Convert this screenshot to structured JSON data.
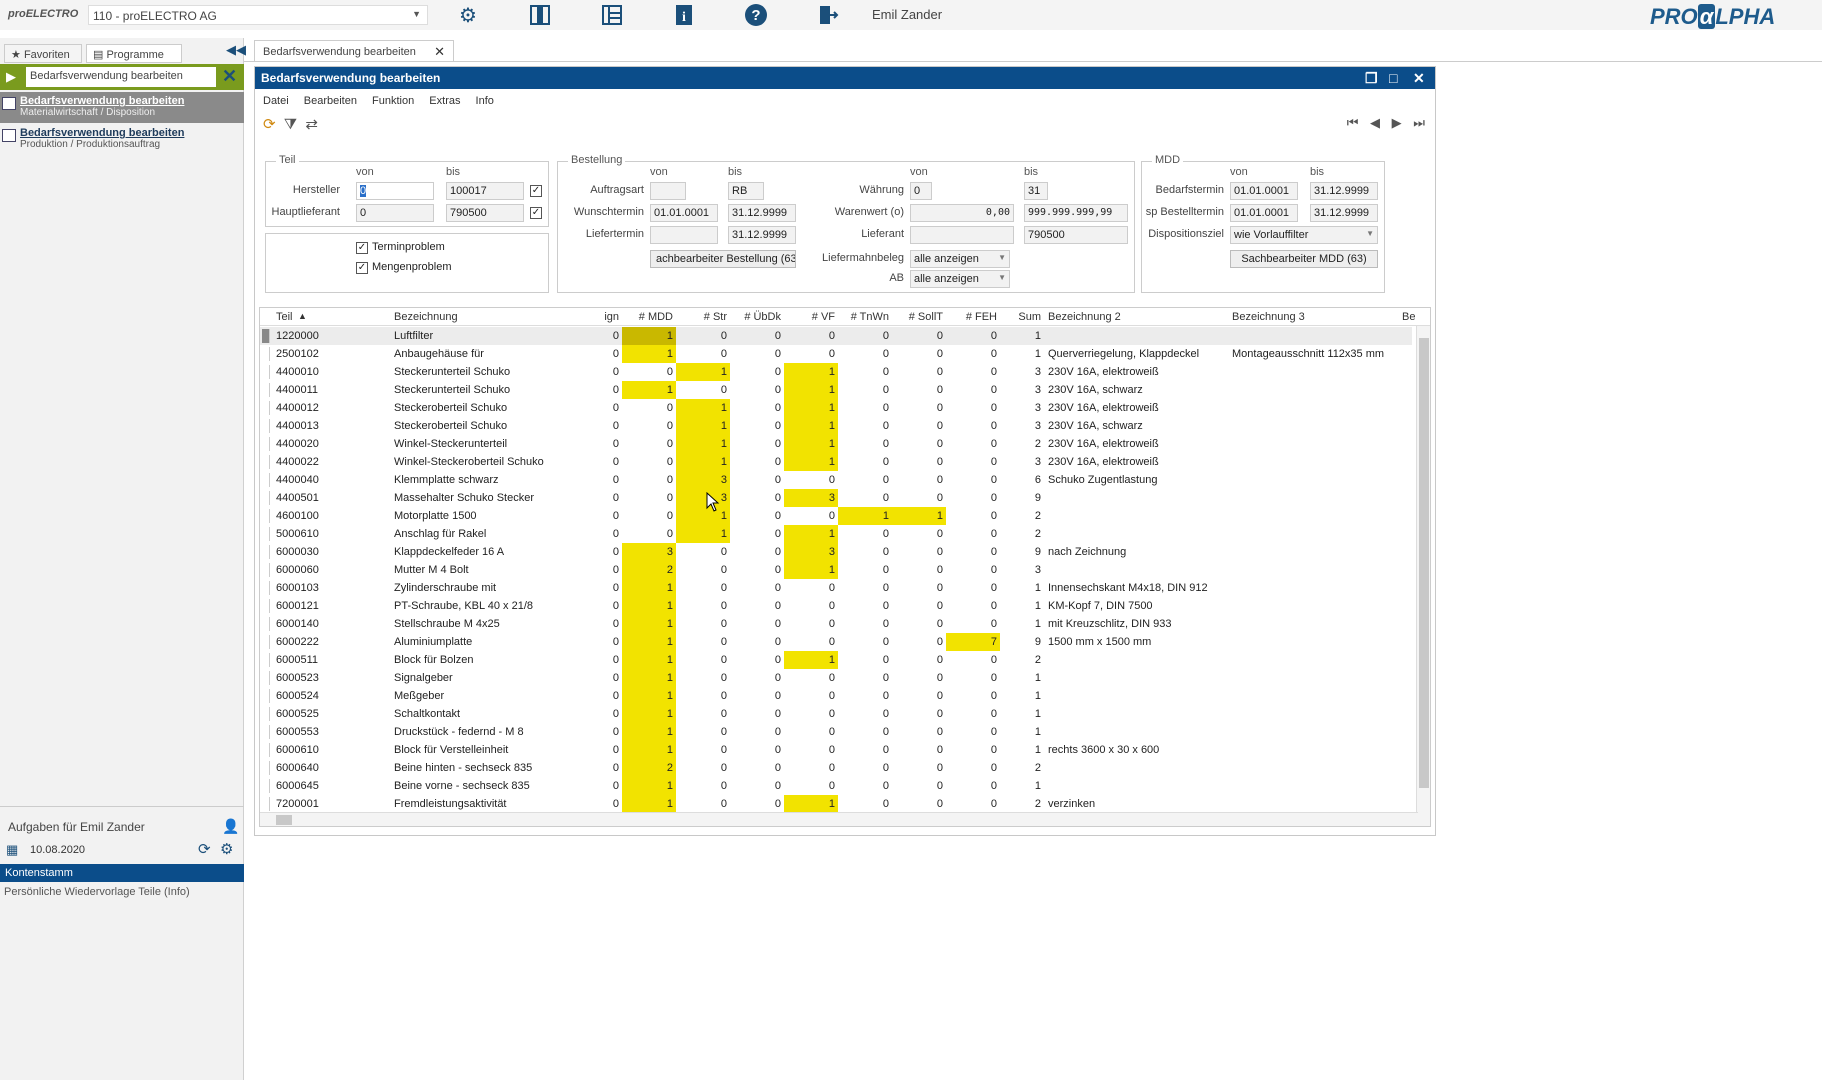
{
  "app": {
    "logo_text": "proELECTRO",
    "company_select": "110 - proELECTRO AG",
    "user": "Emil Zander",
    "brand": "PRO",
    "brand_alpha": "α",
    "brand_suffix": "LPHA"
  },
  "left": {
    "tab_favorites": "Favoriten",
    "tab_programs": "Programme",
    "search_value": "Bedarfsverwendung bearbeiten",
    "items": [
      {
        "title": "Bedarfsverwendung bearbeiten",
        "sub": "Materialwirtschaft / Disposition"
      },
      {
        "title": "Bedarfsverwendung bearbeiten",
        "sub": "Produktion / Produktionsauftrag"
      }
    ],
    "tasks_title": "Aufgaben für Emil Zander",
    "tasks_date": "10.08.2020",
    "tasks_bar": "Kontenstamm",
    "tasks_item": "Persönliche Wiedervorlage Teile (Info)"
  },
  "tab": {
    "label": "Bedarfsverwendung bearbeiten"
  },
  "window": {
    "title": "Bedarfsverwendung bearbeiten",
    "menu": [
      "Datei",
      "Bearbeiten",
      "Funktion",
      "Extras",
      "Info"
    ]
  },
  "filters": {
    "teil": {
      "label": "Teil",
      "von": "von",
      "bis": "bis",
      "hersteller_label": "Hersteller",
      "hersteller_von": "0",
      "hersteller_bis": "100017",
      "hauptlieferant_label": "Hauptlieferant",
      "hauptlieferant_von": "0",
      "hauptlieferant_bis": "790500",
      "terminproblem": "Terminproblem",
      "mengenproblem": "Mengenproblem"
    },
    "bestellung": {
      "label": "Bestellung",
      "von": "von",
      "bis": "bis",
      "auftragsart_label": "Auftragsart",
      "auftragsart_von": "",
      "auftragsart_bis": "RB",
      "wunschtermin_label": "Wunschtermin",
      "wunschtermin_von": "01.01.0001",
      "wunschtermin_bis": "31.12.9999",
      "liefertermin_label": "Liefertermin",
      "liefertermin_von": "",
      "liefertermin_bis": "31.12.9999",
      "sachbearbeiter_btn": "achbearbeiter Bestellung (63",
      "von2": "von",
      "bis2": "bis",
      "waehrung_label": "Währung",
      "waehrung_von": "0",
      "waehrung_bis": "31",
      "warenwert_label": "Warenwert (o)",
      "warenwert_von": "0,00",
      "warenwert_bis": "999.999.999,99",
      "lieferant_label": "Lieferant",
      "lieferant_von": "",
      "lieferant_bis": "790500",
      "liefermahnbeleg_label": "Liefermahnbeleg",
      "liefermahnbeleg_value": "alle anzeigen",
      "ab_label": "AB",
      "ab_value": "alle anzeigen"
    },
    "mdd": {
      "label": "MDD",
      "von": "von",
      "bis": "bis",
      "bedarfstermin_label": "Bedarfstermin",
      "bedarfstermin_von": "01.01.0001",
      "bedarfstermin_bis": "31.12.9999",
      "spbestelltermin_label": "sp Bestelltermin",
      "spbestelltermin_von": "01.01.0001",
      "spbestelltermin_bis": "31.12.9999",
      "dispositionsziel_label": "Dispositionsziel",
      "dispositionsziel_value": "wie Vorlauffilter",
      "sachbearbeiter_btn": "Sachbearbeiter MDD (63)"
    }
  },
  "table": {
    "columns": [
      "Teil",
      "Bezeichnung",
      "ign",
      "# MDD",
      "# Str",
      "# ÜbDk",
      "# VF",
      "# TnWn",
      "# SollT",
      "# FEH",
      "Sum",
      "Bezeichnung 2",
      "Bezeichnung 3",
      "Be"
    ],
    "rows": [
      [
        "1220000",
        "Luftfilter",
        "0",
        "1",
        "0",
        "0",
        "0",
        "0",
        "0",
        "0",
        "1",
        "",
        ""
      ],
      [
        "2500102",
        "Anbaugehäuse für",
        "0",
        "1",
        "0",
        "0",
        "0",
        "0",
        "0",
        "0",
        "1",
        "Querverriegelung, Klappdeckel",
        "Montageausschnitt 112x35 mm"
      ],
      [
        "4400010",
        "Steckerunterteil Schuko",
        "0",
        "0",
        "1",
        "0",
        "1",
        "0",
        "0",
        "0",
        "3",
        "230V 16A, elektroweiß",
        ""
      ],
      [
        "4400011",
        "Steckerunterteil Schuko",
        "0",
        "1",
        "0",
        "0",
        "1",
        "0",
        "0",
        "0",
        "3",
        "230V 16A, schwarz",
        ""
      ],
      [
        "4400012",
        "Steckeroberteil Schuko",
        "0",
        "0",
        "1",
        "0",
        "1",
        "0",
        "0",
        "0",
        "3",
        "230V 16A, elektroweiß",
        ""
      ],
      [
        "4400013",
        "Steckeroberteil Schuko",
        "0",
        "0",
        "1",
        "0",
        "1",
        "0",
        "0",
        "0",
        "3",
        "230V 16A, schwarz",
        ""
      ],
      [
        "4400020",
        "Winkel-Steckerunterteil",
        "0",
        "0",
        "1",
        "0",
        "1",
        "0",
        "0",
        "0",
        "2",
        "230V 16A, elektroweiß",
        ""
      ],
      [
        "4400022",
        "Winkel-Steckeroberteil Schuko",
        "0",
        "0",
        "1",
        "0",
        "1",
        "0",
        "0",
        "0",
        "3",
        "230V 16A, elektroweiß",
        ""
      ],
      [
        "4400040",
        "Klemmplatte schwarz",
        "0",
        "0",
        "3",
        "0",
        "0",
        "0",
        "0",
        "0",
        "6",
        "Schuko Zugentlastung",
        ""
      ],
      [
        "4400501",
        "Massehalter Schuko Stecker",
        "0",
        "0",
        "3",
        "0",
        "3",
        "0",
        "0",
        "0",
        "9",
        "",
        ""
      ],
      [
        "4600100",
        "Motorplatte 1500",
        "0",
        "0",
        "1",
        "0",
        "0",
        "1",
        "1",
        "0",
        "2",
        "",
        ""
      ],
      [
        "5000610",
        "Anschlag für Rakel",
        "0",
        "0",
        "1",
        "0",
        "1",
        "0",
        "0",
        "0",
        "2",
        "",
        ""
      ],
      [
        "6000030",
        "Klappdeckelfeder 16 A",
        "0",
        "3",
        "0",
        "0",
        "3",
        "0",
        "0",
        "0",
        "9",
        "nach Zeichnung",
        ""
      ],
      [
        "6000060",
        "Mutter M 4 Bolt",
        "0",
        "2",
        "0",
        "0",
        "1",
        "0",
        "0",
        "0",
        "3",
        "",
        ""
      ],
      [
        "6000103",
        "Zylinderschraube mit",
        "0",
        "1",
        "0",
        "0",
        "0",
        "0",
        "0",
        "0",
        "1",
        "Innensechskant M4x18, DIN 912",
        ""
      ],
      [
        "6000121",
        "PT-Schraube, KBL 40 x 21/8",
        "0",
        "1",
        "0",
        "0",
        "0",
        "0",
        "0",
        "0",
        "1",
        "KM-Kopf 7, DIN 7500",
        ""
      ],
      [
        "6000140",
        "Stellschraube M 4x25",
        "0",
        "1",
        "0",
        "0",
        "0",
        "0",
        "0",
        "0",
        "1",
        "mit Kreuzschlitz, DIN 933",
        ""
      ],
      [
        "6000222",
        "Aluminiumplatte",
        "0",
        "1",
        "0",
        "0",
        "0",
        "0",
        "0",
        "7",
        "9",
        "1500 mm x 1500 mm",
        ""
      ],
      [
        "6000511",
        "Block für Bolzen",
        "0",
        "1",
        "0",
        "0",
        "1",
        "0",
        "0",
        "0",
        "2",
        "",
        ""
      ],
      [
        "6000523",
        "Signalgeber",
        "0",
        "1",
        "0",
        "0",
        "0",
        "0",
        "0",
        "0",
        "1",
        "",
        ""
      ],
      [
        "6000524",
        "Meßgeber",
        "0",
        "1",
        "0",
        "0",
        "0",
        "0",
        "0",
        "0",
        "1",
        "",
        ""
      ],
      [
        "6000525",
        "Schaltkontakt",
        "0",
        "1",
        "0",
        "0",
        "0",
        "0",
        "0",
        "0",
        "1",
        "",
        ""
      ],
      [
        "6000553",
        "Druckstück - federnd - M 8",
        "0",
        "1",
        "0",
        "0",
        "0",
        "0",
        "0",
        "0",
        "1",
        "",
        ""
      ],
      [
        "6000610",
        "Block für Verstelleinheit",
        "0",
        "1",
        "0",
        "0",
        "0",
        "0",
        "0",
        "0",
        "1",
        "rechts 3600 x 30 x 600",
        ""
      ],
      [
        "6000640",
        "Beine hinten - sechseck 835",
        "0",
        "2",
        "0",
        "0",
        "0",
        "0",
        "0",
        "0",
        "2",
        "",
        ""
      ],
      [
        "6000645",
        "Beine vorne - sechseck 835",
        "0",
        "1",
        "0",
        "0",
        "0",
        "0",
        "0",
        "0",
        "1",
        "",
        ""
      ],
      [
        "7200001",
        "Fremdleistungsaktivität",
        "0",
        "1",
        "0",
        "0",
        "1",
        "0",
        "0",
        "0",
        "2",
        "verzinken",
        ""
      ]
    ],
    "highlight": [
      [
        3
      ],
      [
        3
      ],
      [
        4,
        6
      ],
      [
        3,
        6
      ],
      [
        4,
        6
      ],
      [
        4,
        6
      ],
      [
        4,
        6
      ],
      [
        4,
        6
      ],
      [
        4
      ],
      [
        4,
        6
      ],
      [
        4,
        7,
        8
      ],
      [
        4,
        6
      ],
      [
        3,
        6
      ],
      [
        3,
        6
      ],
      [
        3
      ],
      [
        3
      ],
      [
        3
      ],
      [
        3,
        9
      ],
      [
        3,
        6
      ],
      [
        3
      ],
      [
        3
      ],
      [
        3
      ],
      [
        3
      ],
      [
        3
      ],
      [
        3
      ],
      [
        3
      ],
      [
        3,
        6
      ]
    ],
    "highlight_color": "#f2e300",
    "selected_color": "#c9b800"
  }
}
